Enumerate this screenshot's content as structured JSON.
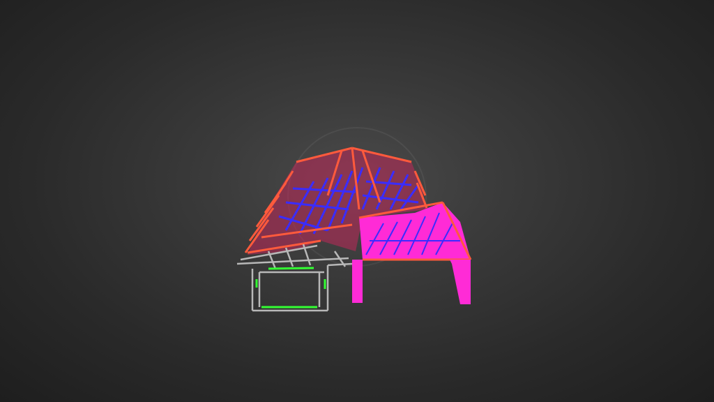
{
  "viewer": {
    "background_color": "#333333",
    "model_colors": {
      "rafters": "#ff5a3c",
      "webbing": "#3a2cff",
      "panels": "#ff2bd6",
      "frame": "#b8b8b8",
      "bracing": "#33ff33"
    }
  }
}
